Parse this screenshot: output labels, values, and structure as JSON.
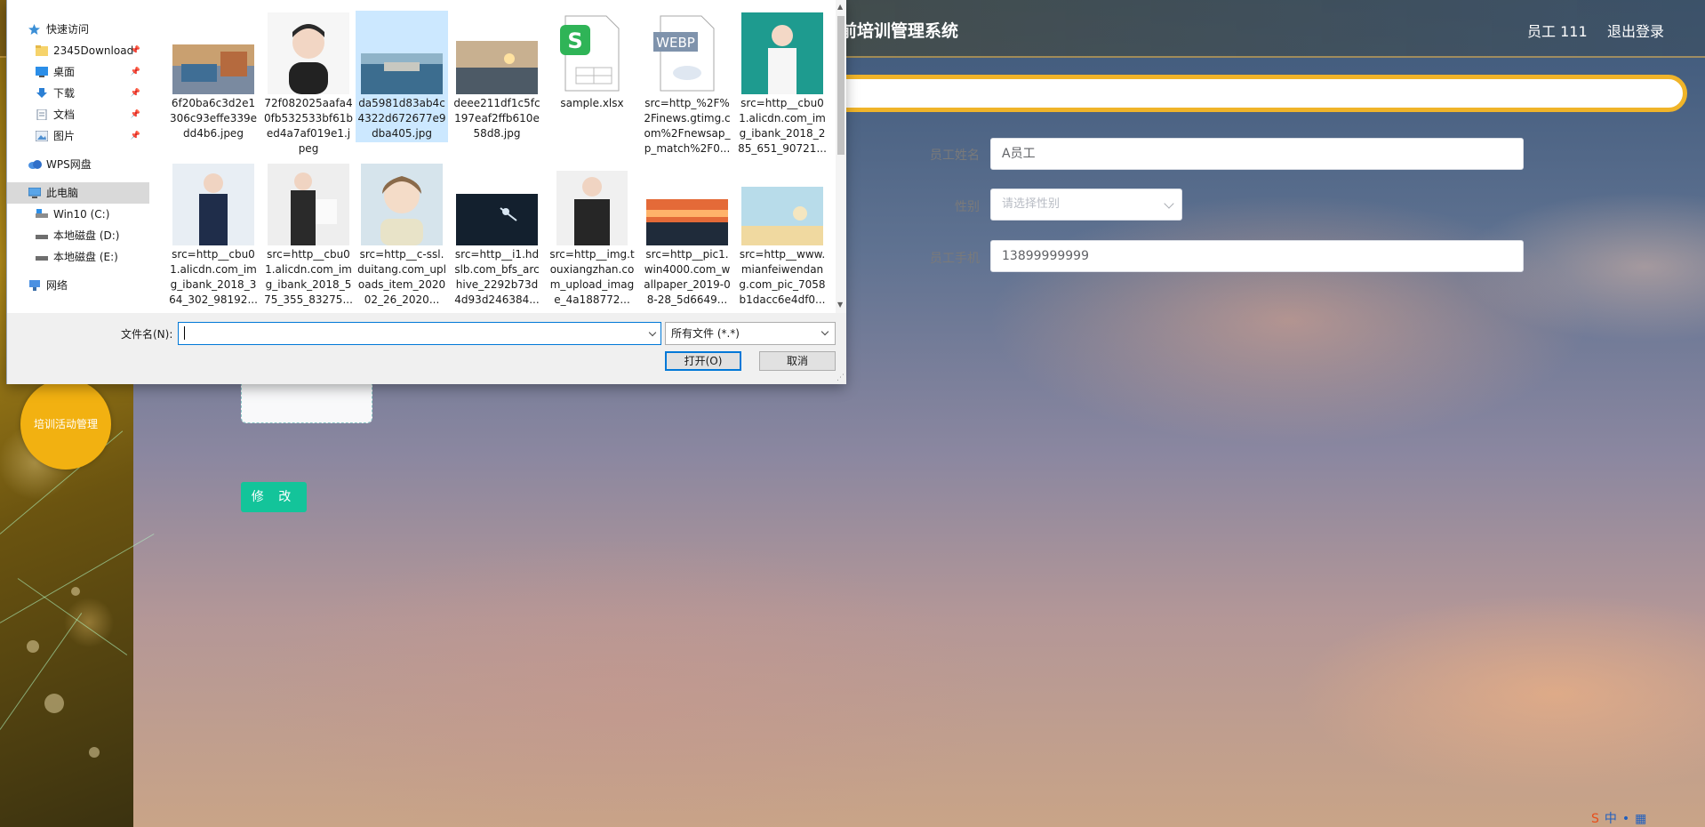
{
  "app": {
    "title_partial": "前培训管理系统",
    "user_label": "员工 111",
    "logout_label": "退出登录"
  },
  "side_menu": {
    "active_item": "培训活动管理"
  },
  "form": {
    "name_label": "员工姓名",
    "name_value": "A员工",
    "gender_label": "性别",
    "gender_placeholder": "请选择性别",
    "phone_label": "员工手机",
    "phone_value": "13899999999",
    "modify_button": "修 改"
  },
  "dialog": {
    "nav": [
      {
        "label": "快速访问",
        "icon": "star-icon"
      },
      {
        "label": "2345Download",
        "icon": "folder-icon",
        "pinned": true
      },
      {
        "label": "桌面",
        "icon": "desktop-icon",
        "pinned": true
      },
      {
        "label": "下载",
        "icon": "download-icon",
        "pinned": true
      },
      {
        "label": "文档",
        "icon": "document-icon",
        "pinned": true
      },
      {
        "label": "图片",
        "icon": "pictures-icon",
        "pinned": true
      },
      {
        "label": "WPS网盘",
        "icon": "cloud-icon"
      },
      {
        "label": "此电脑",
        "icon": "computer-icon",
        "selected": true
      },
      {
        "label": "Win10 (C:)",
        "icon": "drive-icon"
      },
      {
        "label": "本地磁盘 (D:)",
        "icon": "drive-icon"
      },
      {
        "label": "本地磁盘 (E:)",
        "icon": "drive-icon"
      },
      {
        "label": "网络",
        "icon": "network-icon"
      }
    ],
    "files": [
      {
        "name": "6f20ba6c3d2e1306c93effe339edd4b6.jpeg",
        "kind": "photo-coast"
      },
      {
        "name": "72f082025aafa40fb532533bf61bed4a7af019e1.jpeg",
        "kind": "avatar-cartoon"
      },
      {
        "name": "da5981d83ab4c4322d672677e9dba405.jpg",
        "kind": "photo-lake",
        "selected": true
      },
      {
        "name": "deee211df1c5fc197eaf2ffb610e58d8.jpg",
        "kind": "photo-sunset-beach"
      },
      {
        "name": "sample.xlsx",
        "kind": "xlsx-icon"
      },
      {
        "name": "src=http_%2F%2Finews.gtimg.com%2Fnewsap_p_match%2F0...",
        "kind": "webp-icon"
      },
      {
        "name": "src=http__cbu01.alicdn.com_img_ibank_2018_285_651_90721...",
        "kind": "photo-woman-white"
      },
      {
        "name": "src=http__cbu01.alicdn.com_img_ibank_2018_364_302_98192...",
        "kind": "photo-woman-suit"
      },
      {
        "name": "src=http__cbu01.alicdn.com_img_ibank_2018_575_355_83275...",
        "kind": "photo-woman-suit2"
      },
      {
        "name": "src=http__c-ssl.duitang.com_uploads_item_202002_26_2020...",
        "kind": "avatar-girl"
      },
      {
        "name": "src=http__i1.hdslb.com_bfs_archive_2292b73d4d93d246384...",
        "kind": "photo-dancer"
      },
      {
        "name": "src=http__img.touxiangzhan.com_upload_image_4a188772...",
        "kind": "photo-man-suit"
      },
      {
        "name": "src=http__pic1.win4000.com_wallpaper_2019-08-28_5d6649...",
        "kind": "photo-sunset"
      },
      {
        "name": "src=http__www.mianfeiwendang.com_pic_7058b1dacc6e4df0...",
        "kind": "photo-beach-illus"
      }
    ],
    "filename_label": "文件名(N):",
    "filename_value": "",
    "filetype_value": "所有文件 (*.*)",
    "open_button": "打开(O)",
    "cancel_button": "取消"
  },
  "colors": {
    "accent_yellow": "#f2b111",
    "button_green": "#13c49a",
    "dialog_focus": "#0078d7"
  }
}
